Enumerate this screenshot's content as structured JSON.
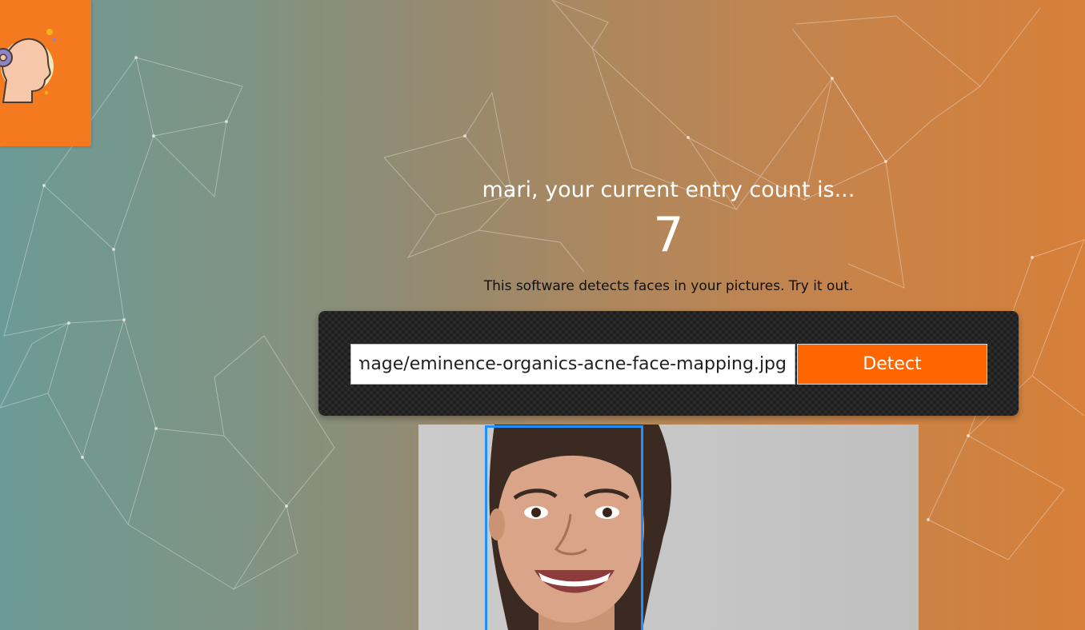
{
  "header": {
    "logo_icon": "head-with-gear-icon",
    "brand_color": "#f5791f"
  },
  "main": {
    "greeting": "mari, your current entry count is...",
    "entry_count": "7",
    "description": "This software detects faces in your pictures. Try it out."
  },
  "detect_form": {
    "url_value": "https://example.com/image/eminence-organics-acne-face-mapping.jpg",
    "button_label": "Detect",
    "button_color": "#ff6600"
  },
  "result": {
    "face_box_color": "#1e90ff",
    "faces_detected": 1
  }
}
